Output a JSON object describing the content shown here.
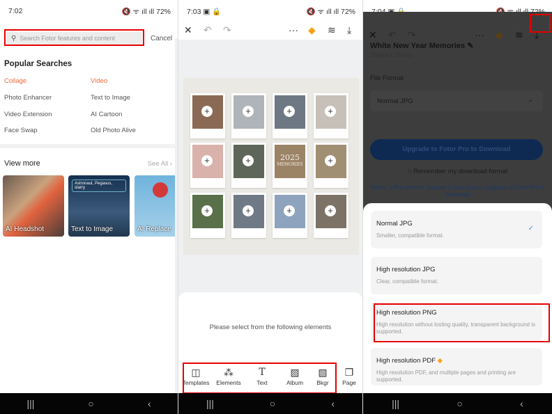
{
  "panel1": {
    "status": {
      "time": "7:02",
      "icons": "🔇 ᯤ ıll ıll",
      "battery": "72%"
    },
    "search": {
      "placeholder": "Search Fotor features and content",
      "cancel": "Cancel"
    },
    "popular": {
      "title": "Popular Searches",
      "items": [
        "Collage",
        "Video",
        "Photo Enhancer",
        "Text to Image",
        "Video Extension",
        "AI Cartoon",
        "Face Swap",
        "Old Photo Alive"
      ]
    },
    "view_more": {
      "title": "View more",
      "see_all": "See All",
      "cards": [
        "AI Headshot",
        "Text to Image",
        "AI Replace"
      ],
      "prompt": "Astronaut, Pegasus, starry"
    }
  },
  "panel2": {
    "status": {
      "time": "7:03",
      "battery": "72%"
    },
    "collage": {
      "year": "2025",
      "label": "MEMORIES"
    },
    "hint": "Please select from the following elements",
    "tools": [
      "Templates",
      "Elements",
      "Text",
      "Album",
      "Bkgr",
      "Page"
    ]
  },
  "panel3": {
    "status": {
      "time": "7:04",
      "battery": "72%"
    },
    "title": "White New Year Memories",
    "size": "1080px x 1080px",
    "file_format_label": "File Format",
    "selected_format": "Normal JPG",
    "upgrade_button": "Upgrade to Fotor Pro to Download",
    "remember": "Remember my download format",
    "notice": "Notice: 1 Pro element included in your project. Upgrade to Fotor Pro to download",
    "options": [
      {
        "title": "Normal JPG",
        "desc": "Smaller, compatible format.",
        "selected": true
      },
      {
        "title": "High resolution JPG",
        "desc": "Clear, compatible format."
      },
      {
        "title": "High resolution PNG",
        "desc": "High resolution without losting quality, transparent background is supported."
      },
      {
        "title": "High resolution PDF",
        "desc": "High resolution PDF, and multiple pages and printing are supported.",
        "pro": true
      }
    ]
  },
  "colors": {
    "accent": "#f06a3c",
    "highlight": "#e60000",
    "pro": "#f7a21b"
  }
}
